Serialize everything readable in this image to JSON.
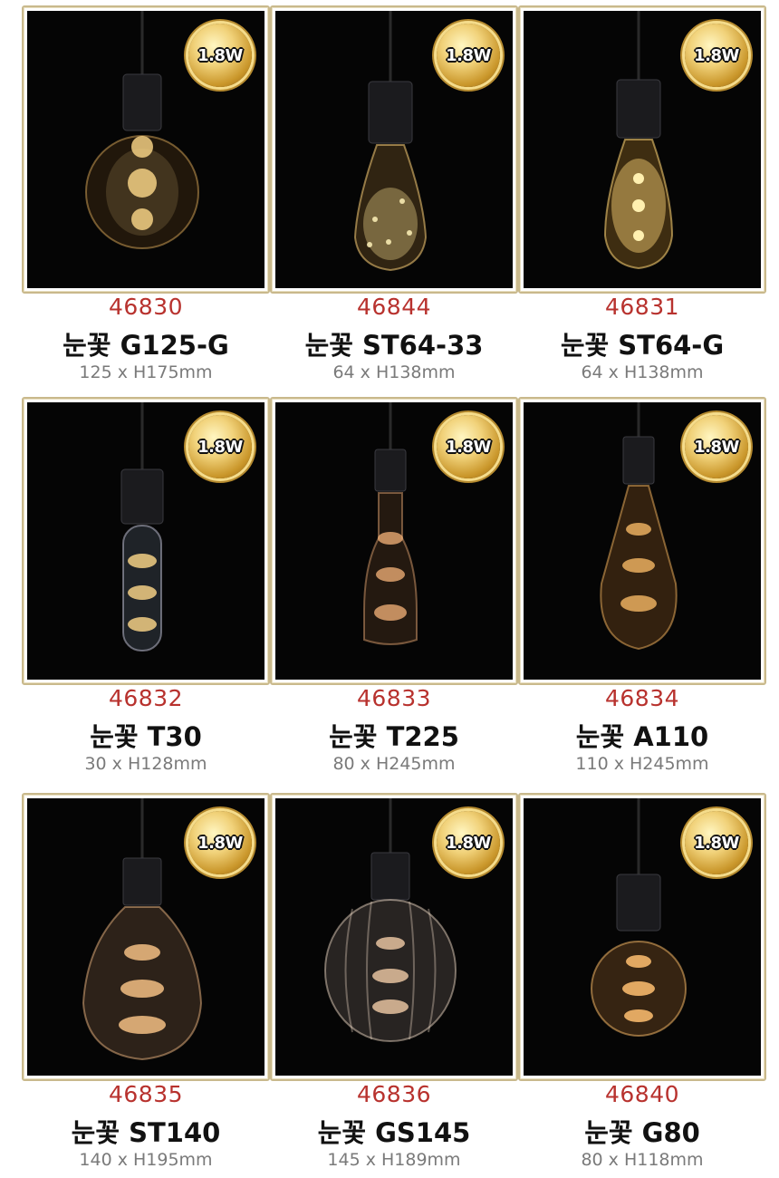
{
  "badge_label": "1.8W",
  "colors": {
    "code": "#b8322e",
    "name": "#111111",
    "size": "#7a7a7a",
    "frame": "#c9b98c",
    "photo_bg": "#050505"
  },
  "products": [
    {
      "code": "46830",
      "name": "눈꽃 G125-G",
      "size": "125 x H175mm",
      "shape": "globe"
    },
    {
      "code": "46844",
      "name": "눈꽃 ST64-33",
      "size": "64 x H138mm",
      "shape": "teardrop"
    },
    {
      "code": "46831",
      "name": "눈꽃 ST64-G",
      "size": "64 x H138mm",
      "shape": "teardrop"
    },
    {
      "code": "46832",
      "name": "눈꽃 T30",
      "size": "30 x H128mm",
      "shape": "tube"
    },
    {
      "code": "46833",
      "name": "눈꽃 T225",
      "size": "80 x H245mm",
      "shape": "bottle"
    },
    {
      "code": "46834",
      "name": "눈꽃 A110",
      "size": "110 x H245mm",
      "shape": "pear"
    },
    {
      "code": "46835",
      "name": "눈꽃 ST140",
      "size": "140 x H195mm",
      "shape": "bigpear"
    },
    {
      "code": "46836",
      "name": "눈꽃 GS145",
      "size": "145 x H189mm",
      "shape": "ribbed"
    },
    {
      "code": "46840",
      "name": "눈꽃 G80",
      "size": "80 x H118mm",
      "shape": "smallglobe"
    }
  ]
}
